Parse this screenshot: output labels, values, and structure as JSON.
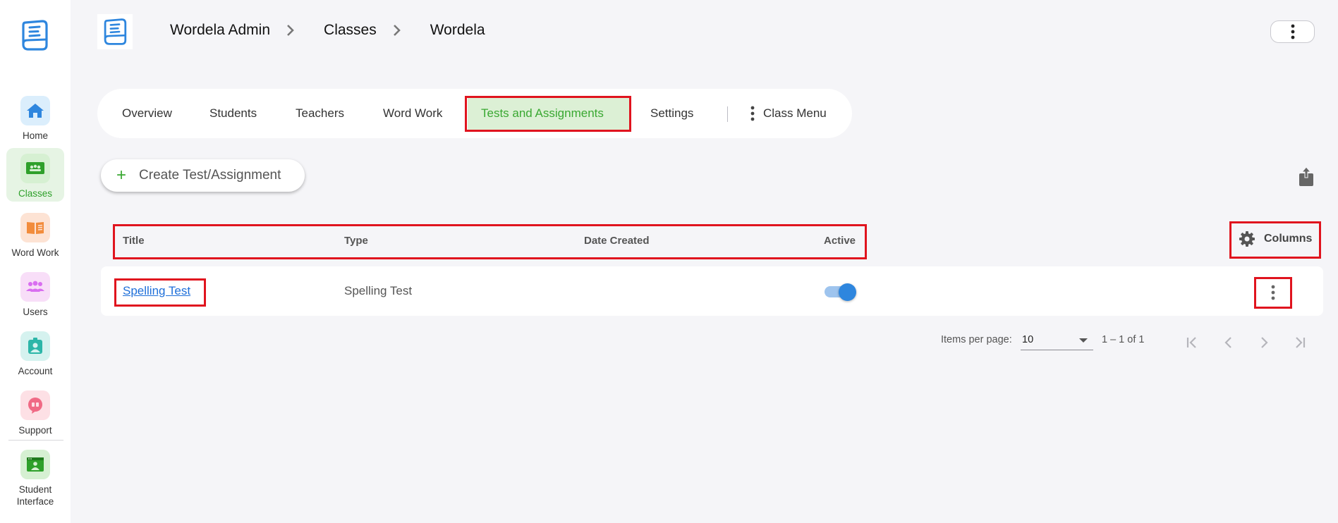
{
  "sidebar": {
    "items": [
      {
        "label": "Home",
        "icon": "home-icon",
        "color": "#2e86de",
        "bg": "#dbeefc"
      },
      {
        "label": "Classes",
        "icon": "classes-icon",
        "color": "#2ea02a",
        "bg": "#d6f0d2"
      },
      {
        "label": "Word Work",
        "icon": "book-icon",
        "color": "#f28c3c",
        "bg": "#fde3d4"
      },
      {
        "label": "Users",
        "icon": "users-icon",
        "color": "#d96ef0",
        "bg": "#f8def8"
      },
      {
        "label": "Account",
        "icon": "account-icon",
        "color": "#2cb6a8",
        "bg": "#d5f2ef"
      },
      {
        "label": "Support",
        "icon": "support-icon",
        "color": "#f06a85",
        "bg": "#fde0e5"
      },
      {
        "label": "Student Interface",
        "icon": "student-interface-icon",
        "color": "#2ea02a",
        "bg": "#d6f0d2"
      }
    ],
    "active": "Classes"
  },
  "header": {
    "breadcrumb": [
      "Wordela Admin",
      "Classes",
      "Wordela"
    ]
  },
  "tabs": {
    "items": [
      "Overview",
      "Students",
      "Teachers",
      "Word Work",
      "Tests and Assignments",
      "Settings"
    ],
    "active": "Tests and Assignments",
    "class_menu": "Class Menu"
  },
  "toolbar": {
    "create_label": "Create Test/Assignment"
  },
  "table": {
    "headers": {
      "title": "Title",
      "type": "Type",
      "date_created": "Date Created",
      "active": "Active"
    },
    "columns_label": "Columns",
    "rows": [
      {
        "title": "Spelling Test",
        "type": "Spelling Test",
        "date_created": "",
        "active": true
      }
    ]
  },
  "paginator": {
    "items_per_page_label": "Items per page:",
    "items_per_page": "10",
    "range": "1 – 1 of 1"
  },
  "colors": {
    "accent_green": "#3aa832",
    "active_tab_bg": "#dcf0d5",
    "link_blue": "#1e6fd9",
    "highlight_red": "#e0141e",
    "toggle_blue": "#2e86de"
  }
}
